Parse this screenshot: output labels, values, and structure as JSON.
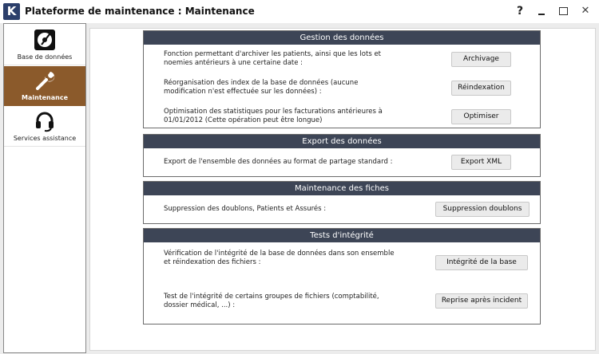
{
  "window": {
    "logo_letter": "K",
    "title": "Plateforme de maintenance : Maintenance",
    "help_label": "?",
    "close_label": "✕"
  },
  "sidebar": {
    "items": [
      {
        "label": "Base de données",
        "icon": "database-disc-icon",
        "selected": false
      },
      {
        "label": "Maintenance",
        "icon": "wrench-icon",
        "selected": true
      },
      {
        "label": "Services assistance",
        "icon": "headset-icon",
        "selected": false
      }
    ]
  },
  "colors": {
    "selected_sidebar": "#8b5a2b",
    "panel_header": "#3d4556",
    "logo_bg": "#2c3f6b"
  },
  "panels": [
    {
      "title": "Gestion des données",
      "rows": [
        {
          "text_1": "Fonction permettant d'archiver les patients, ainsi que les lots et",
          "text_2": "noemies antérieurs à une certaine date :",
          "button": "Archivage"
        },
        {
          "text_1": "Réorganisation des index de la base de données (aucune",
          "text_2": "modification n'est effectuée sur les données) :",
          "button": "Réindexation"
        },
        {
          "text_1": "Optimisation des statistiques pour les facturations antérieures à",
          "text_2": "01/01/2012 (Cette opération peut être longue)",
          "button": "Optimiser"
        }
      ]
    },
    {
      "title": "Export des données",
      "rows": [
        {
          "text_1": "Export de l'ensemble des données au format de partage standard :",
          "button": "Export XML"
        }
      ]
    },
    {
      "title": "Maintenance des fiches",
      "rows": [
        {
          "text_1": "Suppression des doublons, Patients et Assurés :",
          "button": "Suppression doublons"
        }
      ]
    },
    {
      "title": "Tests d'intégrité",
      "rows": [
        {
          "text_1": "Vérification de l'intégrité de la base de données dans son ensemble",
          "text_2": "et réindexation des fichiers :",
          "button": "Intégrité de la base"
        },
        {
          "text_1": "Test de l'intégrité de certains groupes de fichiers (comptabilité,",
          "text_2": "dossier médical, ...) :",
          "button": "Reprise après incident"
        }
      ]
    }
  ]
}
